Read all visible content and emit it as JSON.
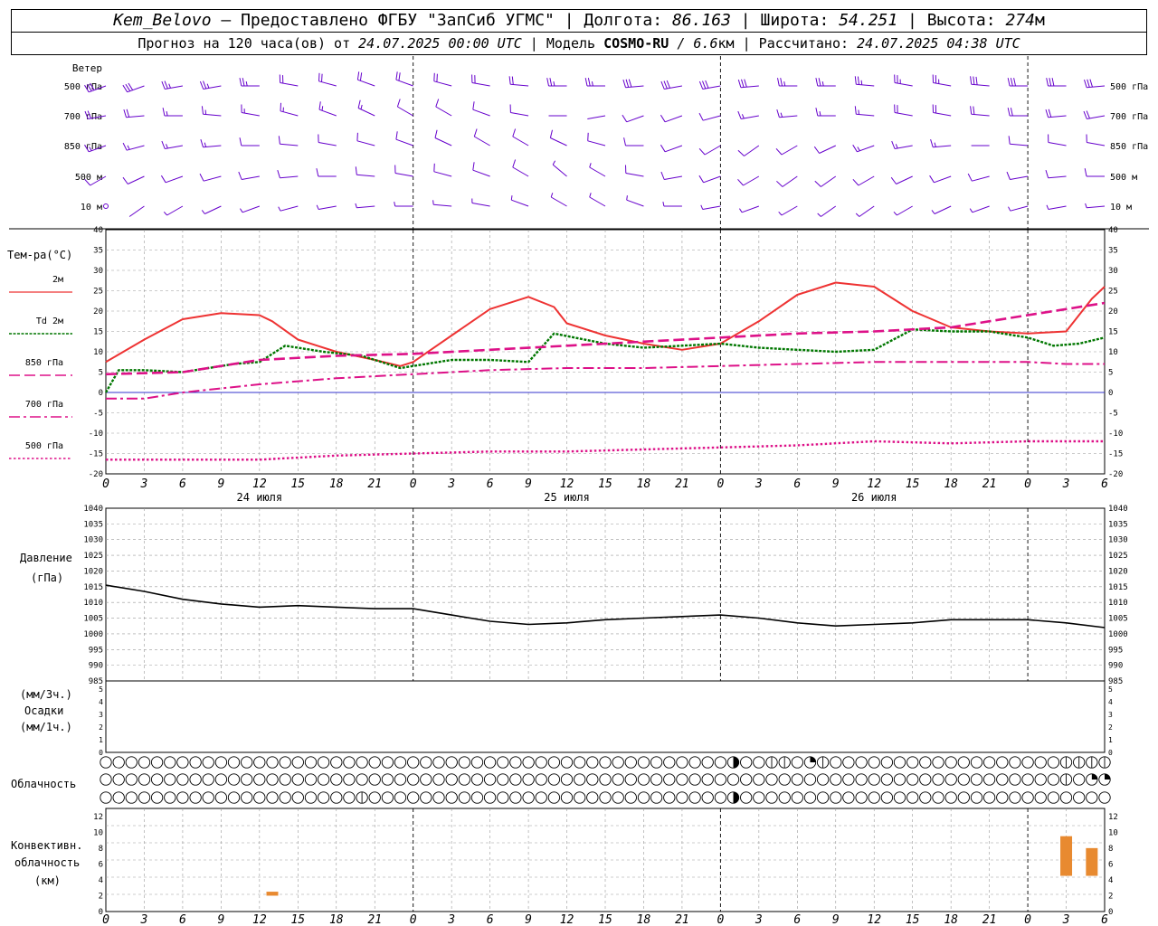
{
  "header": {
    "station": "Kem_Belovo",
    "provider": " – Предоставлено ФГБУ \"ЗапСиб УГМС\" | ",
    "lon_label": "Долгота: ",
    "lon": "86.163",
    "lat_label": " | Широта: ",
    "lat": "54.251",
    "alt_label": " | Высота: ",
    "alt": "274",
    "alt_unit": "м",
    "forecast_label": "Прогноз на 120 часа(ов) от ",
    "forecast_start": "24.07.2025 00:00 UTC",
    "model_label": "  | Модель ",
    "model": "COSMO-RU",
    "resolution": " / 6.6",
    "resolution_unit": "км",
    "calc_label": " | Рассчитано: ",
    "calc_time": "24.07.2025 04:38 UTC"
  },
  "colors": {
    "t2m": "#ee3333",
    "td2m": "#007700",
    "t850": "#dd1188",
    "t700": "#dd1188",
    "t500": "#dd1188",
    "wind": "#6600cc",
    "pressure": "#000000",
    "zero_line": "#3333cc",
    "convective": "#e88a30",
    "grid": "#999999"
  },
  "panels": {
    "wind": {
      "title": "Ветер",
      "levels": [
        "500 гПа",
        "700 гПа",
        "850 гПа",
        "500 м",
        "10  м"
      ]
    },
    "temperature": {
      "title": "Тем-ра(°C)",
      "ticks": [
        "40",
        "35",
        "30",
        "25",
        "20",
        "15",
        "10",
        "5",
        "0",
        "-5",
        "-10",
        "-15",
        "-20"
      ],
      "legend": [
        {
          "label": "2м",
          "style": "solid",
          "series": "t2m"
        },
        {
          "label": "Td  2м",
          "style": "dotted",
          "series": "td2m"
        },
        {
          "label": "850 гПа",
          "style": "dash",
          "series": "t850"
        },
        {
          "label": "700 гПа",
          "style": "dashdot",
          "series": "t700"
        },
        {
          "label": "500 гПа",
          "style": "dot",
          "series": "t500"
        }
      ]
    },
    "pressure": {
      "title": "Давление",
      "unit": "(гПа)",
      "ticks": [
        "1040",
        "1035",
        "1030",
        "1025",
        "1020",
        "1015",
        "1010",
        "1005",
        "1000",
        "995",
        "990",
        "985"
      ]
    },
    "precip": {
      "title": "Осадки",
      "unit_top": "(мм/3ч.)",
      "unit_bottom": "(мм/1ч.)",
      "ticks": [
        "5",
        "4",
        "3",
        "2",
        "1",
        "0"
      ]
    },
    "clouds": {
      "title": "Облачность"
    },
    "convective": {
      "title_lines": [
        "Конвективн.",
        "облачность",
        "(км)"
      ],
      "ticks": [
        "12",
        "10",
        "8",
        "6",
        "4",
        "2",
        "0"
      ]
    }
  },
  "time_axis": {
    "hour_labels": [
      "0",
      "3",
      "6",
      "9",
      "12",
      "15",
      "18",
      "21",
      "0",
      "3",
      "6",
      "9",
      "12",
      "15",
      "18",
      "21",
      "0",
      "3",
      "6",
      "9",
      "12",
      "15",
      "18",
      "21",
      "0",
      "3",
      "6"
    ],
    "day_labels": [
      "24 июля",
      "25 июля",
      "26 июля"
    ]
  },
  "chart_data": {
    "type": "line",
    "x_unit": "hours from 24.07.2025 00:00 UTC",
    "xlim": [
      0,
      78
    ],
    "temperature": {
      "ylim": [
        -20,
        40
      ],
      "series": [
        {
          "name": "2м",
          "x": [
            0,
            3,
            6,
            9,
            12,
            13,
            15,
            18,
            21,
            23,
            24,
            27,
            30,
            33,
            35,
            36,
            39,
            42,
            45,
            48,
            51,
            54,
            57,
            60,
            63,
            66,
            69,
            72,
            75,
            77,
            78
          ],
          "values": [
            7.5,
            13,
            18,
            19.5,
            19,
            17.5,
            13,
            10,
            8,
            6.5,
            7.5,
            14,
            20.5,
            23.5,
            21,
            17,
            14,
            12,
            10.5,
            12,
            17.5,
            24,
            27,
            26,
            20,
            16,
            15,
            14.5,
            15,
            23,
            26
          ]
        },
        {
          "name": "Td  2м",
          "x": [
            0,
            1,
            3,
            6,
            9,
            10,
            12,
            14,
            17,
            20,
            22,
            23,
            25,
            27,
            30,
            33,
            35,
            39,
            42,
            45,
            48,
            51,
            54,
            57,
            60,
            63,
            66,
            69,
            72,
            74,
            76,
            78
          ],
          "values": [
            0,
            5.5,
            5.5,
            5,
            6.5,
            7,
            7.5,
            11.5,
            10,
            9,
            7,
            6,
            7,
            8,
            8,
            7.5,
            14.5,
            12,
            11,
            11.5,
            12,
            11,
            10.5,
            10,
            10.5,
            15.5,
            15,
            15,
            13.5,
            11.5,
            12,
            13.5
          ]
        },
        {
          "name": "850 гПа",
          "x": [
            0,
            6,
            12,
            18,
            24,
            30,
            36,
            42,
            48,
            54,
            60,
            66,
            72,
            75,
            78
          ],
          "values": [
            4.5,
            5,
            8,
            9,
            9.5,
            10.5,
            11.5,
            12.5,
            13.5,
            14.5,
            15,
            16,
            19,
            20.5,
            22
          ]
        },
        {
          "name": "700 гПа",
          "x": [
            0,
            3,
            6,
            12,
            18,
            24,
            30,
            36,
            42,
            48,
            54,
            60,
            66,
            72,
            75,
            78
          ],
          "values": [
            -1.5,
            -1.5,
            0,
            2,
            3.5,
            4.5,
            5.5,
            6,
            6,
            6.5,
            7,
            7.5,
            7.5,
            7.5,
            7,
            7
          ]
        },
        {
          "name": "500 гПа",
          "x": [
            0,
            6,
            12,
            18,
            24,
            30,
            36,
            42,
            48,
            54,
            60,
            66,
            72,
            78
          ],
          "values": [
            -16.5,
            -16.5,
            -16.5,
            -15.5,
            -15,
            -14.5,
            -14.5,
            -14,
            -13.5,
            -13,
            -12,
            -12.5,
            -12,
            -12
          ]
        }
      ]
    },
    "pressure": {
      "ylim": [
        985,
        1040
      ],
      "x": [
        0,
        3,
        6,
        9,
        12,
        15,
        18,
        21,
        24,
        27,
        30,
        33,
        36,
        39,
        42,
        45,
        48,
        51,
        54,
        57,
        60,
        63,
        66,
        69,
        72,
        75,
        78
      ],
      "values": [
        1015.5,
        1013.5,
        1011,
        1009.5,
        1008.5,
        1009,
        1008.5,
        1008,
        1008,
        1006,
        1004,
        1003,
        1003.5,
        1004.5,
        1005,
        1005.5,
        1006,
        1005,
        1003.5,
        1002.5,
        1003,
        1003.5,
        1004.5,
        1004.5,
        1004.5,
        1003.5,
        1002
      ]
    },
    "precipitation": {
      "ylim": [
        0,
        5
      ],
      "values": []
    },
    "convective_cloud": {
      "ylim": [
        0,
        13
      ],
      "bars": [
        {
          "x": 13,
          "base": 2,
          "top": 2.5
        },
        {
          "x": 75,
          "base": 4.5,
          "top": 9.5
        },
        {
          "x": 77,
          "base": 4.5,
          "top": 8
        }
      ]
    },
    "cloud_cover": {
      "steps": 79,
      "rows": [
        {
          "name": "upper",
          "cells": "0000000000000000000000000000000000000000000000000300110210000000000000000001111300344200444444"
        },
        {
          "name": "middle",
          "cells": "0000000000000000000000000000000000000000000000000000000000000000000000000001022420002443"
        },
        {
          "name": "lower",
          "cells": "0000000000000000000010000000000000000000000000000300000000000000000000000000000000000"
        }
      ]
    },
    "wind_barbs": {
      "note": "wind direction (deg) and speed (m/s) at 3h steps",
      "levels": [
        {
          "name": "500 гПа",
          "dir": [
            250,
            250,
            260,
            260,
            270,
            280,
            285,
            290,
            290,
            285,
            280,
            275,
            270,
            270,
            265,
            260,
            260,
            265,
            270,
            270,
            275,
            280,
            280,
            275,
            270,
            270,
            265
          ],
          "speed": [
            15,
            15,
            14,
            14,
            13,
            12,
            12,
            10,
            10,
            10,
            12,
            12,
            13,
            14,
            15,
            15,
            16,
            15,
            14,
            14,
            13,
            13,
            14,
            15,
            15,
            16,
            15
          ]
        },
        {
          "name": "700 гПа",
          "dir": [
            260,
            265,
            270,
            275,
            280,
            285,
            290,
            295,
            300,
            300,
            290,
            280,
            270,
            260,
            250,
            250,
            255,
            260,
            265,
            270,
            275,
            280,
            280,
            275,
            270,
            265,
            260
          ],
          "speed": [
            10,
            10,
            9,
            9,
            9,
            8,
            8,
            8,
            7,
            6,
            6,
            5,
            2,
            2,
            5,
            6,
            7,
            8,
            8,
            9,
            9,
            10,
            10,
            10,
            10,
            11,
            11
          ]
        },
        {
          "name": "850 гПа",
          "dir": [
            250,
            255,
            260,
            265,
            270,
            275,
            280,
            285,
            290,
            295,
            300,
            300,
            295,
            285,
            270,
            250,
            240,
            235,
            240,
            245,
            250,
            260,
            265,
            270,
            275,
            280,
            280
          ],
          "speed": [
            8,
            8,
            8,
            8,
            7,
            7,
            7,
            6,
            6,
            6,
            6,
            5,
            5,
            5,
            6,
            6,
            7,
            7,
            7,
            7,
            8,
            8,
            8,
            2,
            7,
            7,
            7
          ]
        },
        {
          "name": "500 м",
          "dir": [
            240,
            245,
            250,
            255,
            260,
            265,
            270,
            275,
            280,
            285,
            290,
            300,
            310,
            300,
            280,
            260,
            250,
            240,
            235,
            235,
            240,
            245,
            250,
            255,
            260,
            265,
            270
          ],
          "speed": [
            5,
            5,
            5,
            6,
            6,
            6,
            6,
            5,
            5,
            5,
            5,
            5,
            4,
            4,
            5,
            5,
            6,
            6,
            6,
            6,
            6,
            6,
            6,
            6,
            6,
            7,
            7
          ]
        },
        {
          "name": "10  м",
          "dir": [
            230,
            235,
            240,
            245,
            250,
            255,
            260,
            265,
            270,
            275,
            280,
            290,
            300,
            300,
            290,
            270,
            260,
            250,
            240,
            235,
            235,
            240,
            245,
            250,
            255,
            260,
            265
          ],
          "speed": [
            1,
            2,
            3,
            3,
            3,
            3,
            3,
            3,
            3,
            3,
            3,
            3,
            3,
            3,
            3,
            3,
            3,
            3,
            3,
            3,
            3,
            3,
            3,
            3,
            3,
            4,
            4
          ]
        }
      ]
    }
  }
}
